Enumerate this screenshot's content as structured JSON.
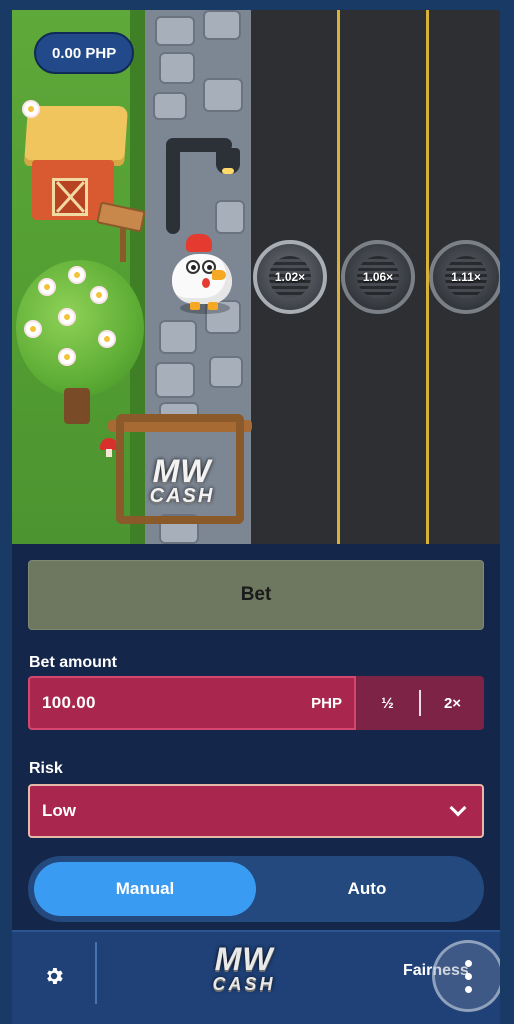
{
  "balance": {
    "amount": "0.00 PHP"
  },
  "multipliers": [
    "1.02×",
    "1.06×",
    "1.11×"
  ],
  "logo": {
    "line1": "MW",
    "line2": "CASH"
  },
  "bet_button": {
    "label": "Bet"
  },
  "bet_amount": {
    "label": "Bet amount",
    "value": "100.00",
    "currency": "PHP",
    "half_label": "½",
    "double_label": "2×"
  },
  "risk": {
    "label": "Risk",
    "selected": "Low"
  },
  "mode": {
    "manual_label": "Manual",
    "auto_label": "Auto",
    "active": "Manual"
  },
  "footer": {
    "fairness_label": "Fairness",
    "settings_icon": "gear-icon",
    "more_icon": "vertical-dots-icon"
  },
  "colors": {
    "bet_button": "#6e7860",
    "field": "#a9264e",
    "toggle_active": "#3a9bf2",
    "footer": "#1f4178"
  }
}
